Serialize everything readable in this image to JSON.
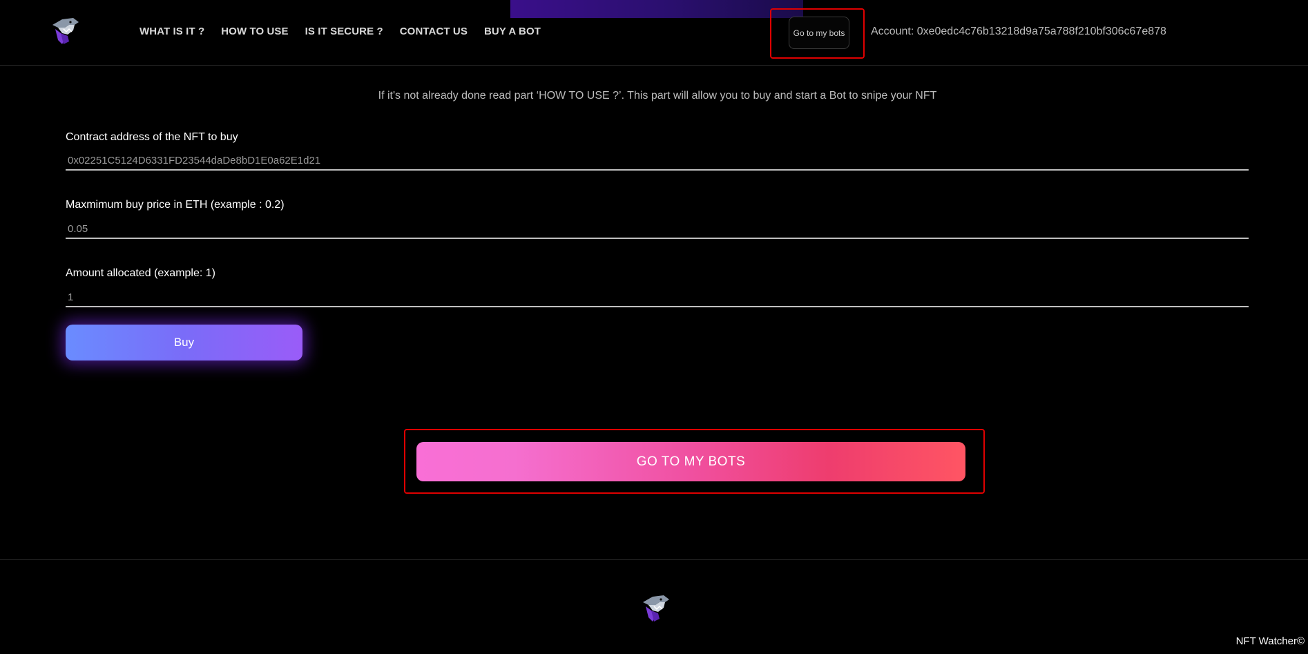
{
  "nav": {
    "items": [
      {
        "label": "WHAT IS IT ?"
      },
      {
        "label": "HOW TO USE"
      },
      {
        "label": "IS IT SECURE ?"
      },
      {
        "label": "CONTACT US"
      },
      {
        "label": "BUY A BOT"
      }
    ]
  },
  "header": {
    "goto_bots_label": "Go to my bots",
    "account_text": "Account: 0xe0edc4c76b13218d9a75a788f210bf306c67e878"
  },
  "main": {
    "intro": "If it's not already done read part ‘HOW TO USE ?’. This part will allow you to buy and start a Bot to snipe your NFT",
    "contract": {
      "label": "Contract address of the NFT to buy",
      "value": "0x02251C5124D6331FD23544daDe8bD1E0a62E1d21"
    },
    "max_price": {
      "label": "Maxmimum buy price in ETH (example : 0.2)",
      "value": "0.05"
    },
    "amount": {
      "label": "Amount allocated (example: 1)",
      "value": "1"
    },
    "buy_label": "Buy",
    "goto_bots_big_label": "GO TO MY BOTS"
  },
  "footer": {
    "copyright": "NFT Watcher©"
  },
  "colors": {
    "background": "#000000",
    "highlight_border": "#e00000",
    "buy_gradient": [
      "#6a8cff",
      "#9a5cf8"
    ],
    "goto_gradient": [
      "#f96fd6",
      "#ff5563"
    ]
  },
  "icons": {
    "logo": "shark-logo-icon"
  }
}
